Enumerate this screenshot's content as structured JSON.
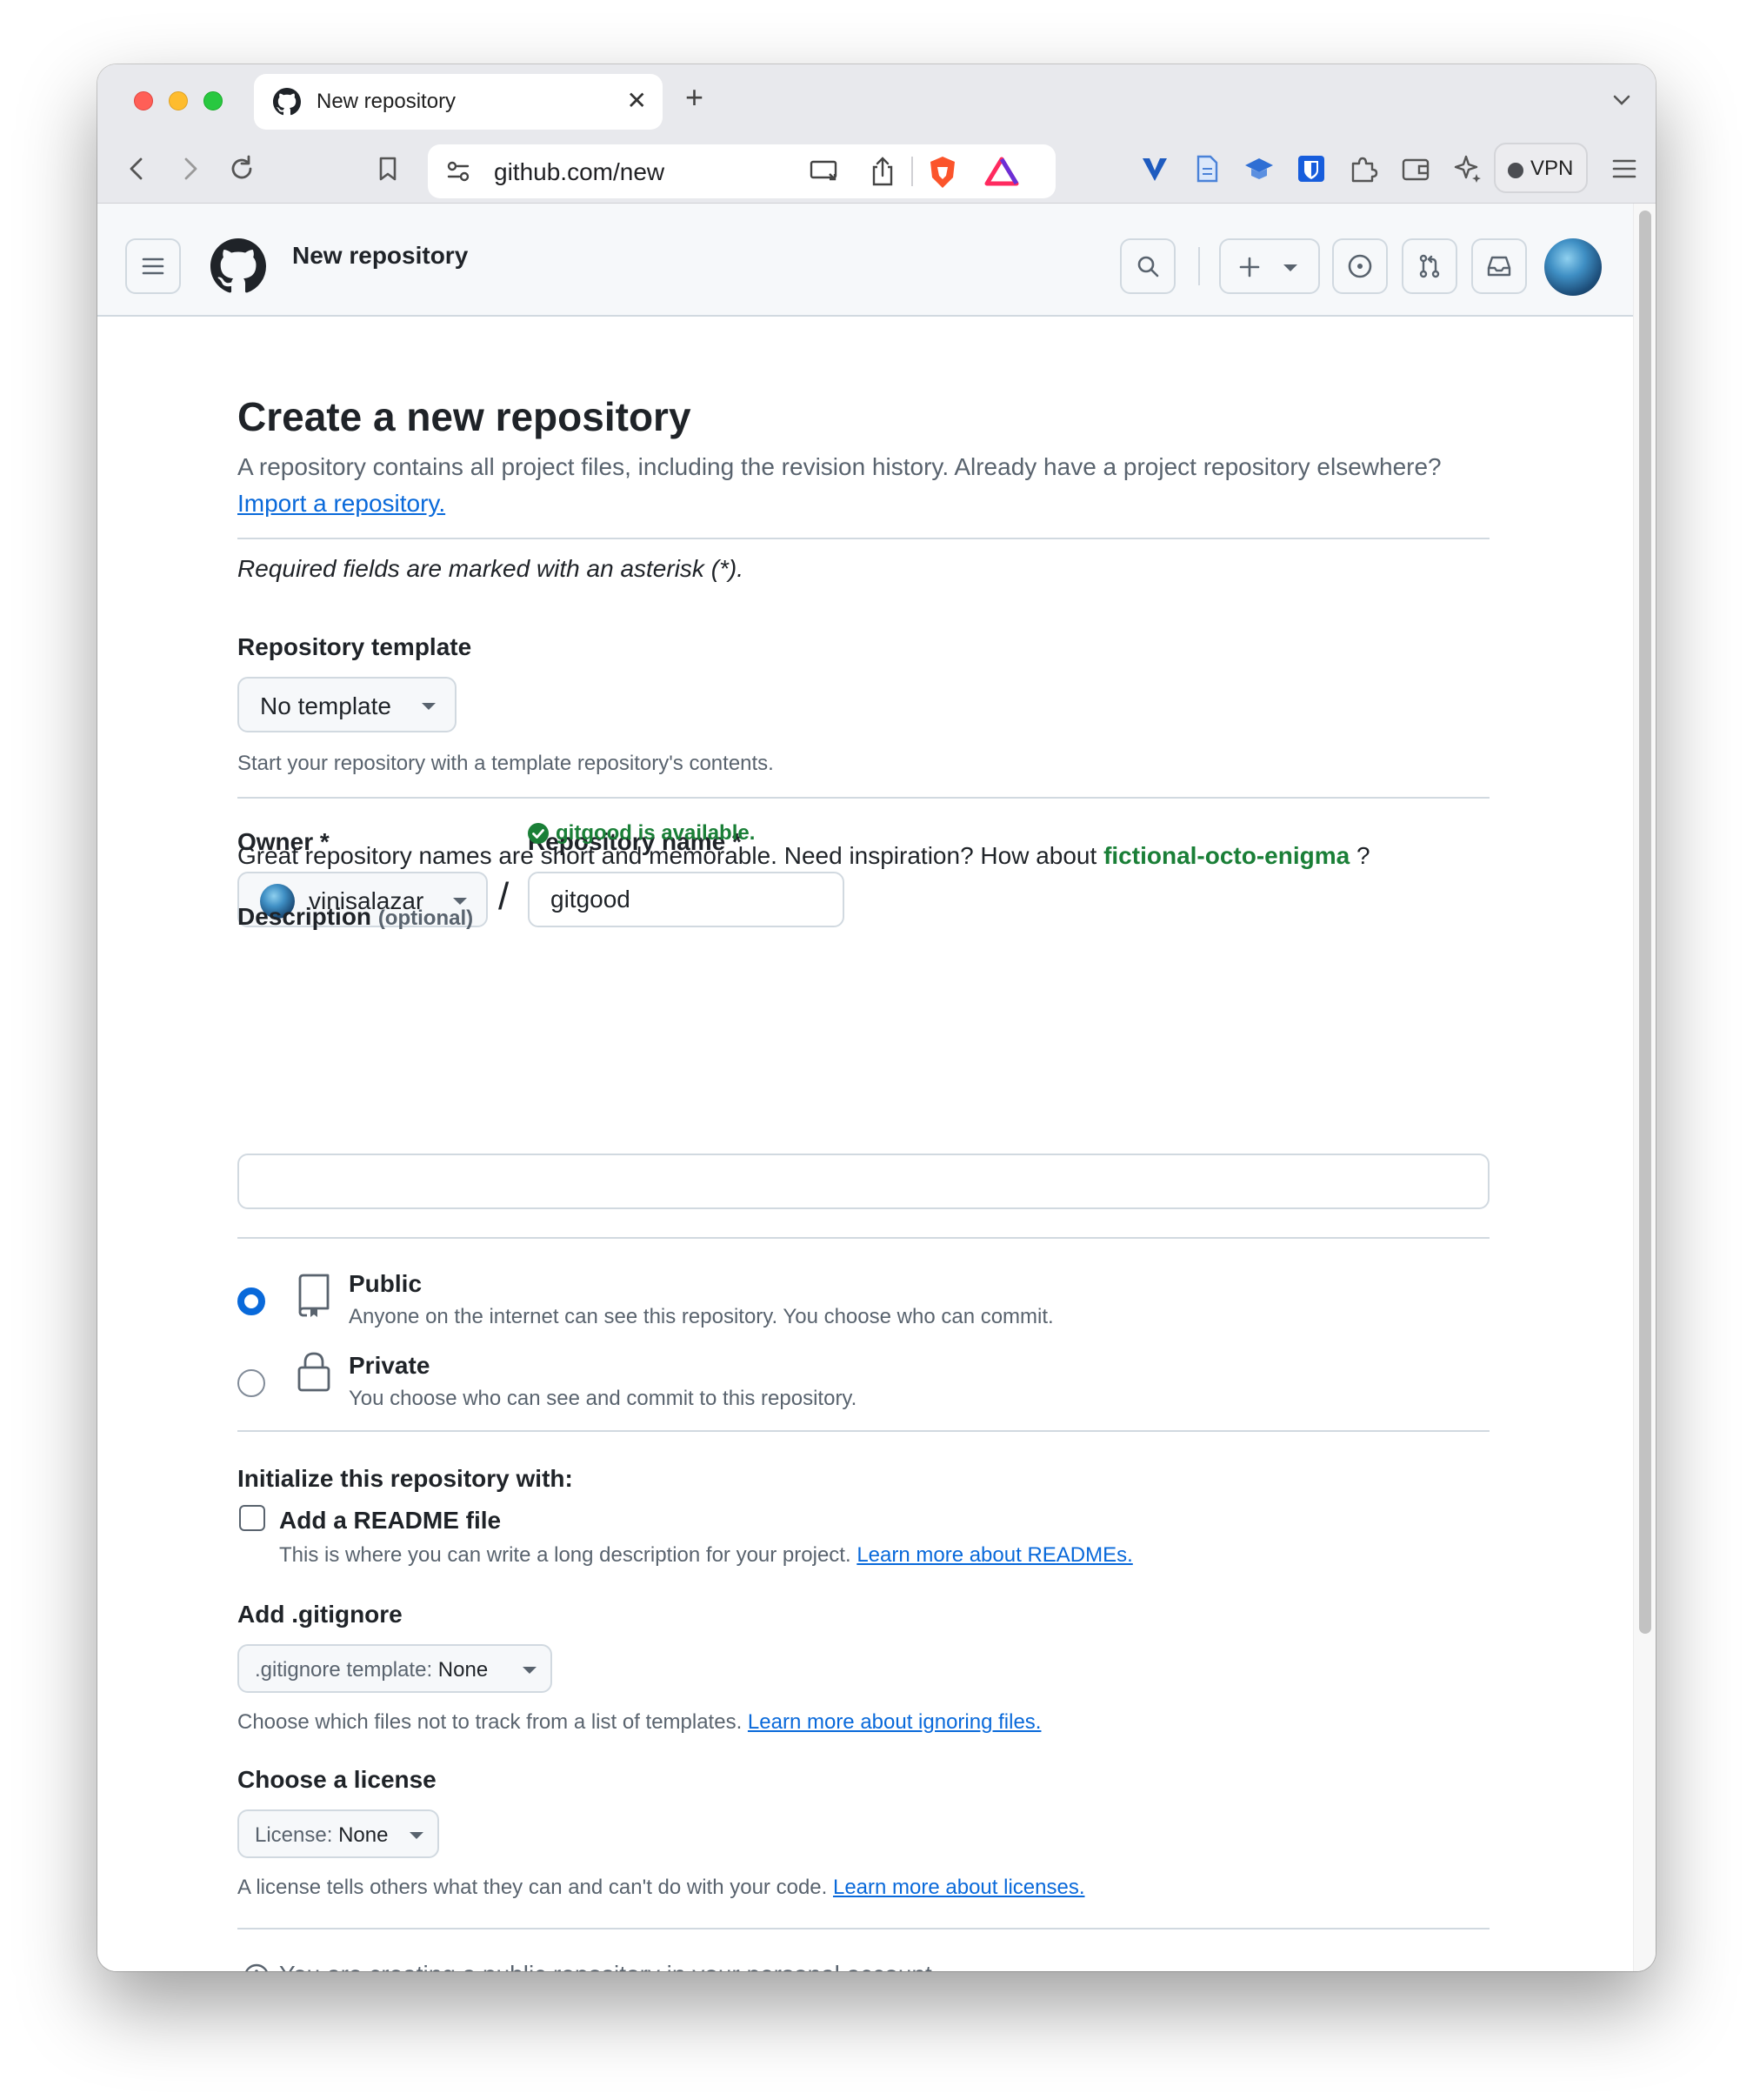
{
  "browser": {
    "tab_title": "New repository",
    "url": "github.com/new",
    "vpn_label": "VPN"
  },
  "header": {
    "title": "New repository"
  },
  "page": {
    "heading": "Create a new repository",
    "lead_text": "A repository contains all project files, including the revision history. Already have a project repository elsewhere?",
    "import_link": "Import a repository.",
    "required_note": "Required fields are marked with an asterisk (*).",
    "template": {
      "label": "Repository template",
      "value": "No template",
      "hint": "Start your repository with a template repository's contents."
    },
    "owner": {
      "label": "Owner *",
      "value": "vinisalazar"
    },
    "separator": "/",
    "repo_name": {
      "label": "Repository name *",
      "value": "gitgood",
      "availability": "gitgood is available."
    },
    "inspiration": {
      "text": "Great repository names are short and memorable. Need inspiration? How about",
      "suggestion": "fictional-octo-enigma",
      "suffix": "?"
    },
    "description": {
      "label": "Description",
      "optional": "(optional)",
      "value": ""
    },
    "visibility": {
      "public_title": "Public",
      "public_desc": "Anyone on the internet can see this repository. You choose who can commit.",
      "private_title": "Private",
      "private_desc": "You choose who can see and commit to this repository.",
      "selected": "public"
    },
    "initialize": {
      "label": "Initialize this repository with:",
      "readme_label": "Add a README file",
      "readme_desc": "This is where you can write a long description for your project.",
      "readme_link": "Learn more about READMEs.",
      "readme_checked": false
    },
    "gitignore": {
      "label": "Add .gitignore",
      "select_prefix": ".gitignore template:",
      "select_value": "None",
      "hint": "Choose which files not to track from a list of templates.",
      "link": "Learn more about ignoring files."
    },
    "license": {
      "label": "Choose a license",
      "select_prefix": "License:",
      "select_value": "None",
      "hint": "A license tells others what they can and can't do with your code.",
      "link": "Learn more about licenses."
    },
    "info_note": "You are creating a public repository in your personal account."
  },
  "colors": {
    "accent": "#0969da",
    "success": "#1a7f37",
    "border": "#d1d9e0",
    "muted": "#59636e"
  }
}
